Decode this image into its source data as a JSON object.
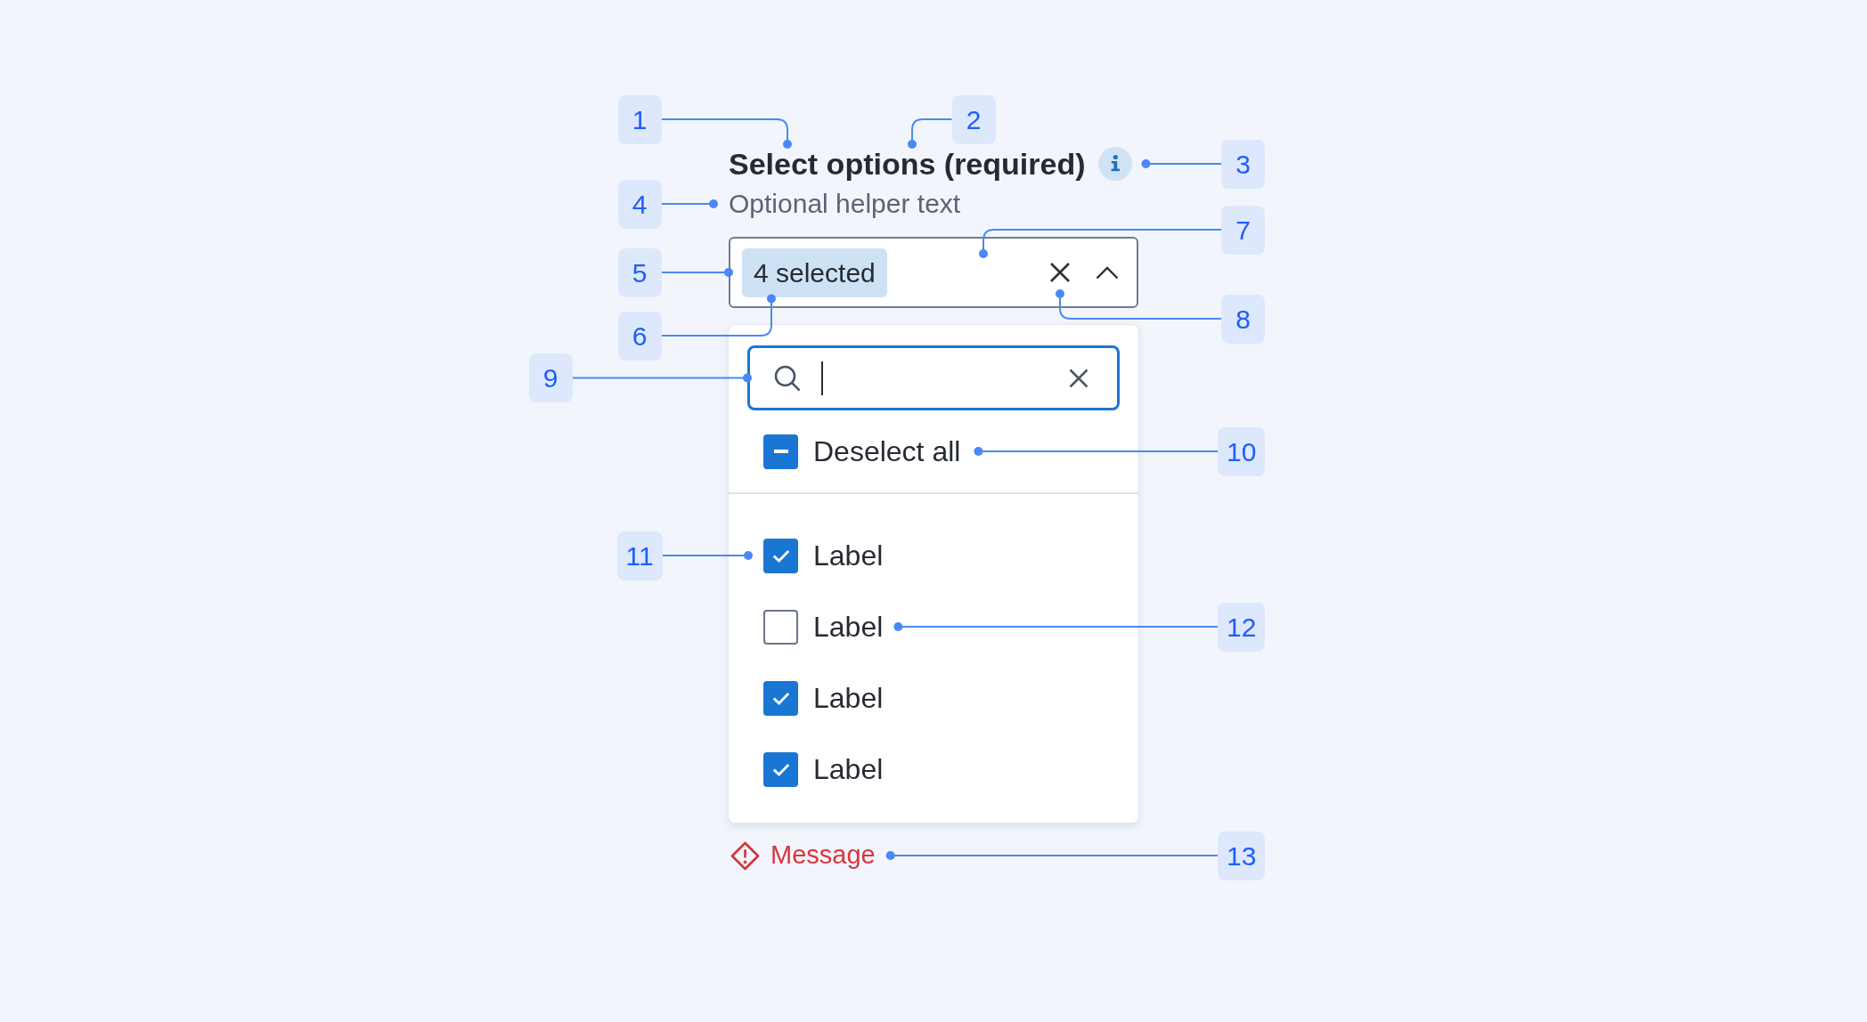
{
  "field": {
    "label": "Select options (required)",
    "helper_text": "Optional helper text",
    "selection_tag": "4 selected",
    "expanded": true
  },
  "dropdown": {
    "search": {
      "focused": true
    },
    "deselect_all": {
      "label": "Deselect all",
      "indeterminate": true
    },
    "options": [
      {
        "label": "Label",
        "checked": true
      },
      {
        "label": "Label",
        "checked": false
      },
      {
        "label": "Label",
        "checked": true
      },
      {
        "label": "Label",
        "checked": true
      }
    ]
  },
  "message": {
    "kind": "error",
    "text": "Message"
  },
  "callouts": [
    {
      "number": "1"
    },
    {
      "number": "2"
    },
    {
      "number": "3"
    },
    {
      "number": "4"
    },
    {
      "number": "5"
    },
    {
      "number": "6"
    },
    {
      "number": "7"
    },
    {
      "number": "8"
    },
    {
      "number": "9"
    },
    {
      "number": "10"
    },
    {
      "number": "11"
    },
    {
      "number": "12"
    },
    {
      "number": "13"
    }
  ]
}
